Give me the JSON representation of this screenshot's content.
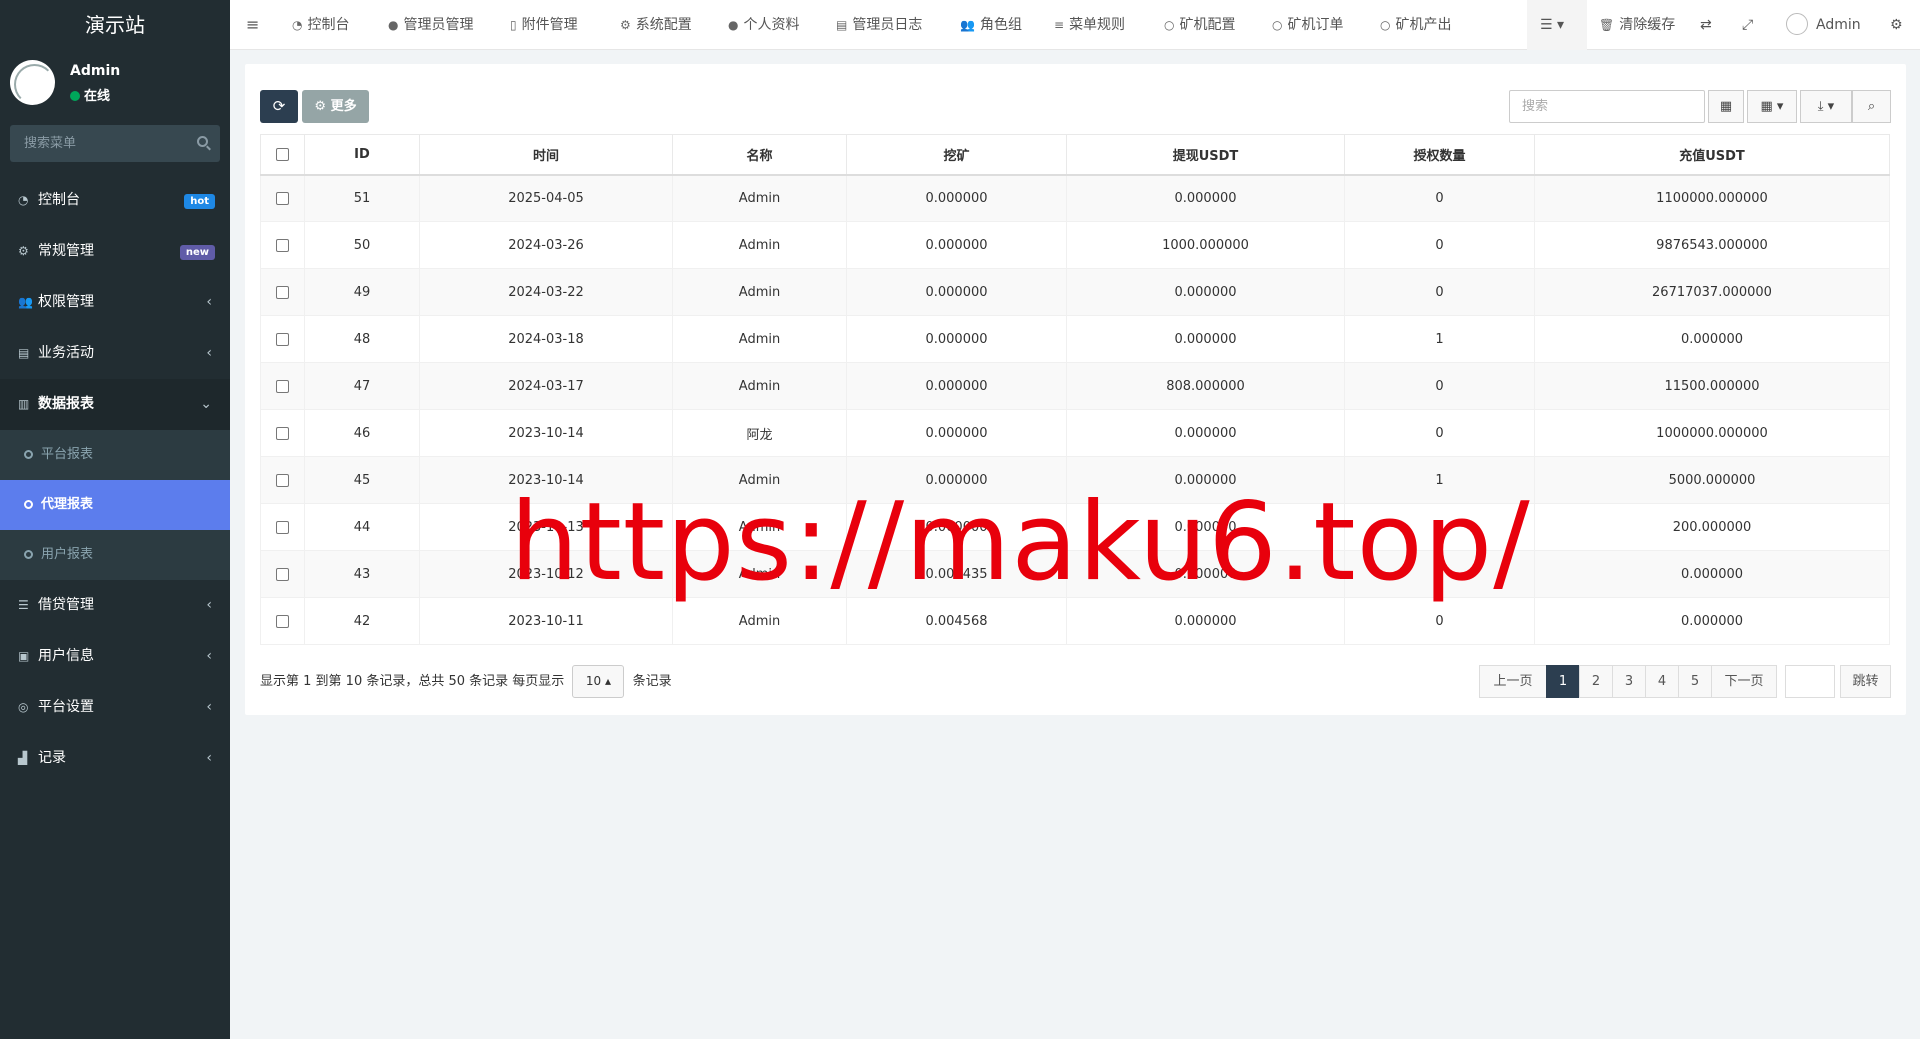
{
  "sidebar": {
    "logo": "演示站",
    "user": {
      "name": "Admin",
      "status": "在线"
    },
    "search_placeholder": "搜索菜单",
    "items": [
      {
        "icon": "dashboard-icon",
        "label": "控制台",
        "badge": "hot"
      },
      {
        "icon": "cogs-icon",
        "label": "常规管理",
        "badge": "new"
      },
      {
        "icon": "group-icon",
        "label": "权限管理"
      },
      {
        "icon": "id-card-icon",
        "label": "业务活动"
      },
      {
        "icon": "file-text-icon",
        "label": "数据报表"
      },
      {
        "icon": "list-icon",
        "label": "借贷管理"
      },
      {
        "icon": "address-book-icon",
        "label": "用户信息"
      },
      {
        "icon": "circle-icon",
        "label": "平台设置"
      },
      {
        "icon": "area-chart-icon",
        "label": "记录"
      }
    ],
    "submenu": [
      {
        "label": "平台报表"
      },
      {
        "label": "代理报表",
        "active": true
      },
      {
        "label": "用户报表"
      }
    ]
  },
  "topnav": {
    "items": [
      {
        "icon": "dashboard-icon",
        "label": "控制台"
      },
      {
        "icon": "user-icon",
        "label": "管理员管理"
      },
      {
        "icon": "file-image-icon",
        "label": "附件管理"
      },
      {
        "icon": "cog-icon",
        "label": "系统配置"
      },
      {
        "icon": "user-icon",
        "label": "个人资料"
      },
      {
        "icon": "list-alt-icon",
        "label": "管理员日志"
      },
      {
        "icon": "group-icon",
        "label": "角色组"
      },
      {
        "icon": "bars-icon",
        "label": "菜单规则"
      },
      {
        "icon": "circle-o-icon",
        "label": "矿机配置"
      },
      {
        "icon": "circle-o-icon",
        "label": "矿机订单"
      },
      {
        "icon": "circle-o-icon",
        "label": "矿机产出"
      }
    ],
    "clear_cache": "清除缓存",
    "user": "Admin"
  },
  "toolbar": {
    "more_label": "更多",
    "search_placeholder": "搜索"
  },
  "table": {
    "columns": [
      "ID",
      "时间",
      "名称",
      "挖矿",
      "提现USDT",
      "授权数量",
      "充值USDT"
    ],
    "rows": [
      [
        "51",
        "2025-04-05",
        "Admin",
        "0.000000",
        "0.000000",
        "0",
        "1100000.000000"
      ],
      [
        "50",
        "2024-03-26",
        "Admin",
        "0.000000",
        "1000.000000",
        "0",
        "9876543.000000"
      ],
      [
        "49",
        "2024-03-22",
        "Admin",
        "0.000000",
        "0.000000",
        "0",
        "26717037.000000"
      ],
      [
        "48",
        "2024-03-18",
        "Admin",
        "0.000000",
        "0.000000",
        "1",
        "0.000000"
      ],
      [
        "47",
        "2024-03-17",
        "Admin",
        "0.000000",
        "808.000000",
        "0",
        "11500.000000"
      ],
      [
        "46",
        "2023-10-14",
        "阿龙",
        "0.000000",
        "0.000000",
        "0",
        "1000000.000000"
      ],
      [
        "45",
        "2023-10-14",
        "Admin",
        "0.000000",
        "0.000000",
        "1",
        "5000.000000"
      ],
      [
        "44",
        "2023-10-13",
        "Admin",
        "0.000000",
        "0.000000",
        "0",
        "200.000000"
      ],
      [
        "43",
        "2023-10-12",
        "Admin",
        "0.004435",
        "0.000000",
        "0",
        "0.000000"
      ],
      [
        "42",
        "2023-10-11",
        "Admin",
        "0.004568",
        "0.000000",
        "0",
        "0.000000"
      ]
    ]
  },
  "pagination": {
    "info_prefix": "显示第 1 到第 10 条记录，总共 50 条记录 每页显示",
    "page_size": "10",
    "info_suffix": "条记录",
    "prev": "上一页",
    "pages": [
      "1",
      "2",
      "3",
      "4",
      "5"
    ],
    "current": "1",
    "next": "下一页",
    "jump": "跳转"
  },
  "watermark": "https://maku6.top/",
  "colors": {
    "sidebar_bg": "#222d32",
    "active_item": "#5c7ded",
    "primary_dark": "#2c3e50",
    "watermark": "#e8000c"
  }
}
